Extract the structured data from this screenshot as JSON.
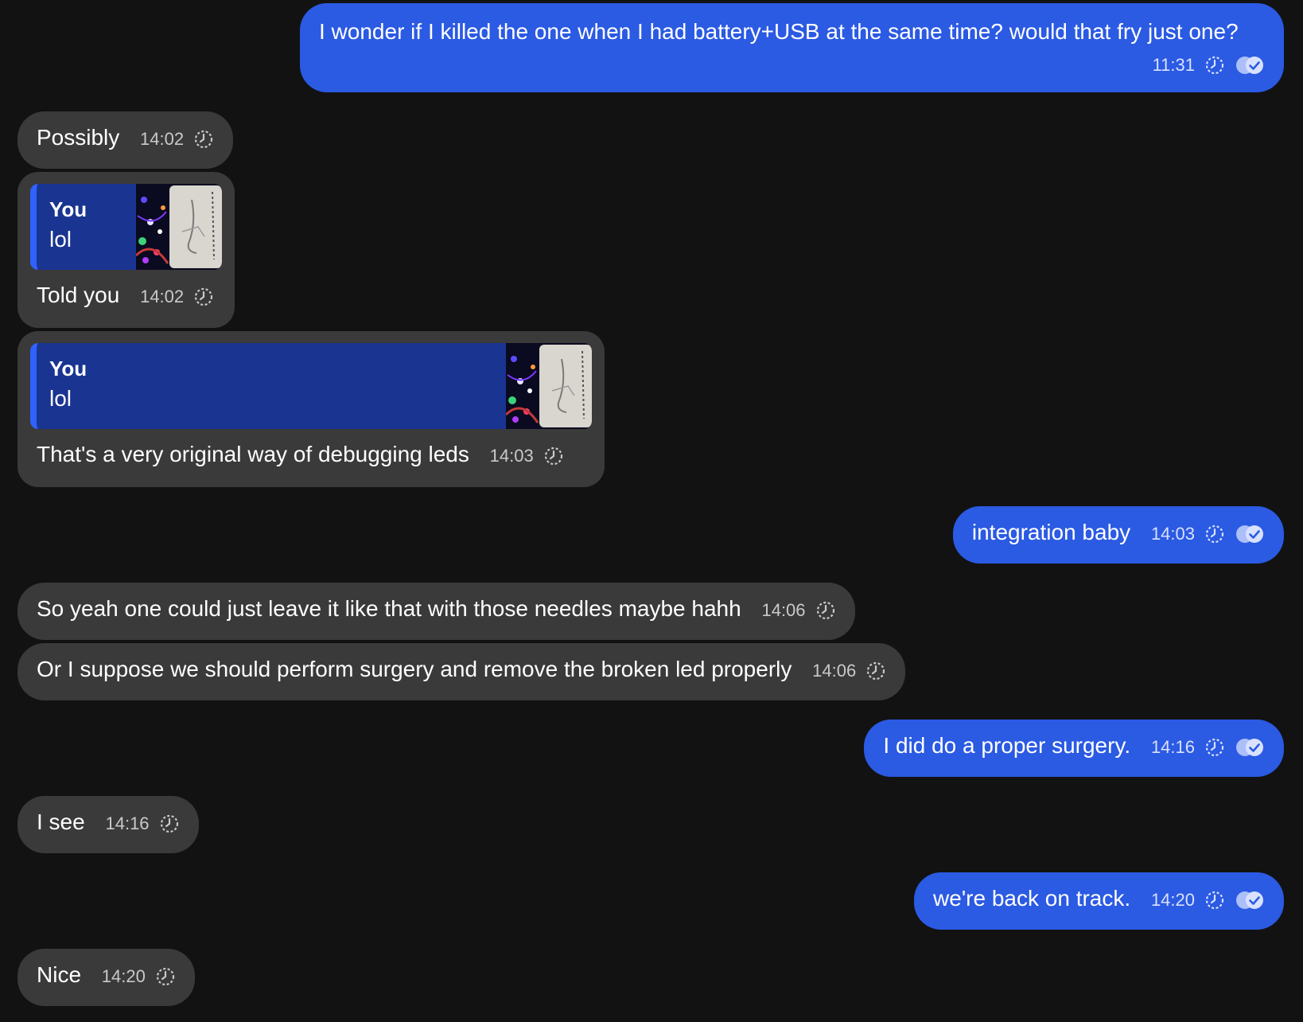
{
  "colors": {
    "background": "#121212",
    "incoming_bubble": "#3a3a3a",
    "outgoing_bubble": "#2b5ae3",
    "reply_quote_bg": "#1a3492",
    "reply_quote_bar": "#2f62ff"
  },
  "icons": {
    "status": "clock-icon",
    "read": "double-check-icon"
  },
  "messages": [
    {
      "id": "m1",
      "direction": "outgoing",
      "text": "I wonder if I killed the one when I had battery+USB at the same time? would that fry just one?",
      "time": "11:31"
    },
    {
      "id": "m2",
      "direction": "incoming",
      "text": "Possibly",
      "time": "14:02"
    },
    {
      "id": "m3",
      "direction": "incoming",
      "reply": {
        "author": "You",
        "text": "lol",
        "has_thumbnail": true
      },
      "text": "Told you",
      "time": "14:02"
    },
    {
      "id": "m4",
      "direction": "incoming",
      "reply": {
        "author": "You",
        "text": "lol",
        "has_thumbnail": true
      },
      "text": "That's a very original way of debugging leds",
      "time": "14:03"
    },
    {
      "id": "m5",
      "direction": "outgoing",
      "text": "integration baby",
      "time": "14:03"
    },
    {
      "id": "m6",
      "direction": "incoming",
      "text": "So yeah one could just leave it like that with those needles maybe hahh",
      "time": "14:06"
    },
    {
      "id": "m7",
      "direction": "incoming",
      "text": "Or I suppose we should perform surgery and remove the broken led properly",
      "time": "14:06"
    },
    {
      "id": "m8",
      "direction": "outgoing",
      "text": "I did do a proper surgery.",
      "time": "14:16"
    },
    {
      "id": "m9",
      "direction": "incoming",
      "text": "I see",
      "time": "14:16"
    },
    {
      "id": "m10",
      "direction": "outgoing",
      "text": "we're back on track.",
      "time": "14:20"
    },
    {
      "id": "m11",
      "direction": "incoming",
      "text": "Nice",
      "time": "14:20"
    }
  ]
}
